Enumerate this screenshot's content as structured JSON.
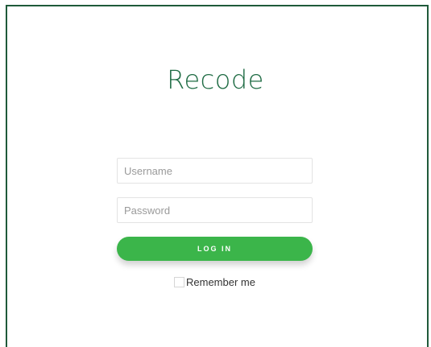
{
  "brand": {
    "title": "Recode"
  },
  "form": {
    "username_placeholder": "Username",
    "password_placeholder": "Password",
    "username_value": "",
    "password_value": "",
    "login_label": "LOG IN",
    "remember_label": "Remember me",
    "remember_checked": false
  },
  "colors": {
    "accent": "#3bb54a",
    "brand_text": "#1e6b43",
    "frame_border": "#1f5a3a"
  }
}
